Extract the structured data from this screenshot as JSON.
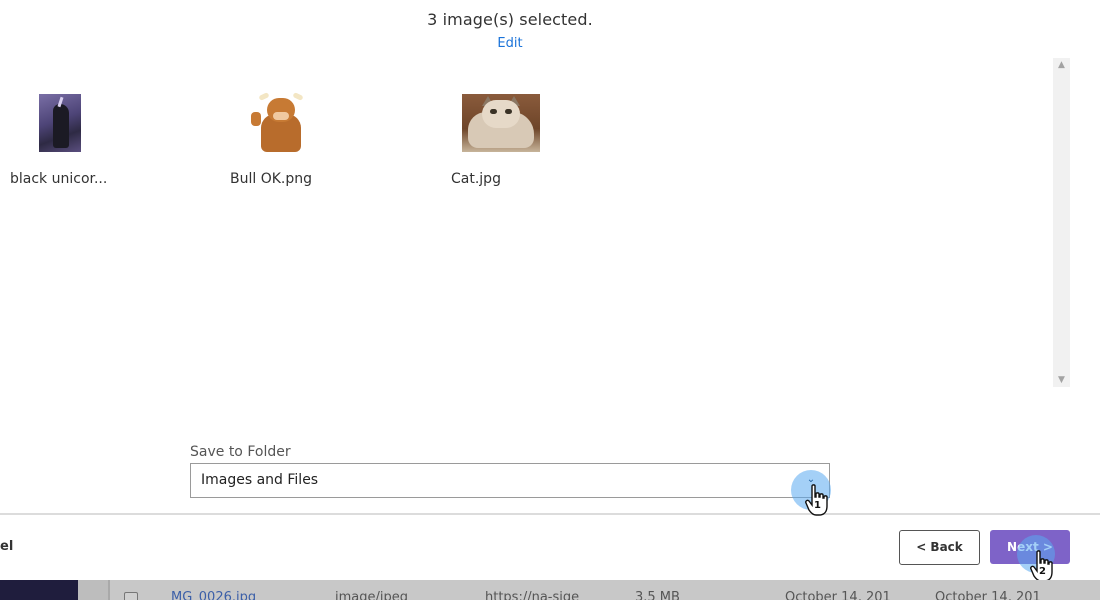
{
  "header": {
    "title": "3 image(s) selected.",
    "edit_label": "Edit"
  },
  "images": [
    {
      "name": "black unicor...",
      "thumbnail": "unicorn-image"
    },
    {
      "name": "Bull OK.png",
      "thumbnail": "bull-image"
    },
    {
      "name": "Cat.jpg",
      "thumbnail": "cat-image"
    }
  ],
  "folder": {
    "label": "Save to Folder",
    "value": "Images and Files"
  },
  "footer": {
    "cancel_partial": "el",
    "back_label": "< Back",
    "next_label": "Next >"
  },
  "cursors": {
    "cursor1_label": "1",
    "cursor2_label": "2"
  },
  "background_row": {
    "filename": "MG_0026.jpg",
    "type": "image/jpeg",
    "url": "https://na-sjge",
    "size": "3.5 MB",
    "created": "October 14, 201",
    "modified": "October 14, 201"
  },
  "colors": {
    "accent": "#7e63c8",
    "link": "#1a73d9",
    "highlight": "#5aaaf0"
  }
}
